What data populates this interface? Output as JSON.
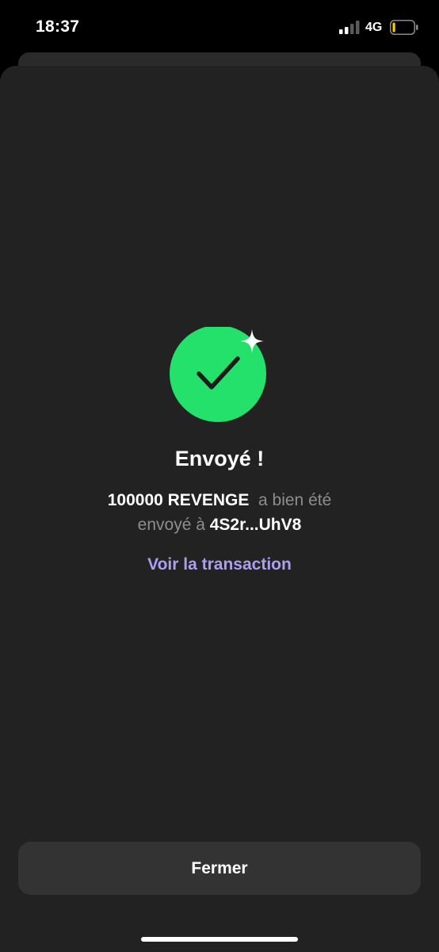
{
  "status_bar": {
    "time": "18:37",
    "network": "4G",
    "signal_bars_active": 2,
    "signal_bars_total": 4,
    "battery_level": 0.1,
    "battery_color": "#ffcc00"
  },
  "success": {
    "icon": "checkmark-sparkle-icon",
    "circle_color": "#23e16a",
    "title": "Envoyé !",
    "amount": "100000 REVENGE",
    "text_sent": "a bien été",
    "text_sent_to": "envoyé à",
    "recipient": "4S2r...UhV8",
    "link_label": "Voir la transaction",
    "link_color": "#ab9ff2"
  },
  "footer": {
    "close_label": "Fermer"
  },
  "colors": {
    "sheet_background": "#222222",
    "button_background": "#333333",
    "muted_text": "#8e8e8e"
  }
}
